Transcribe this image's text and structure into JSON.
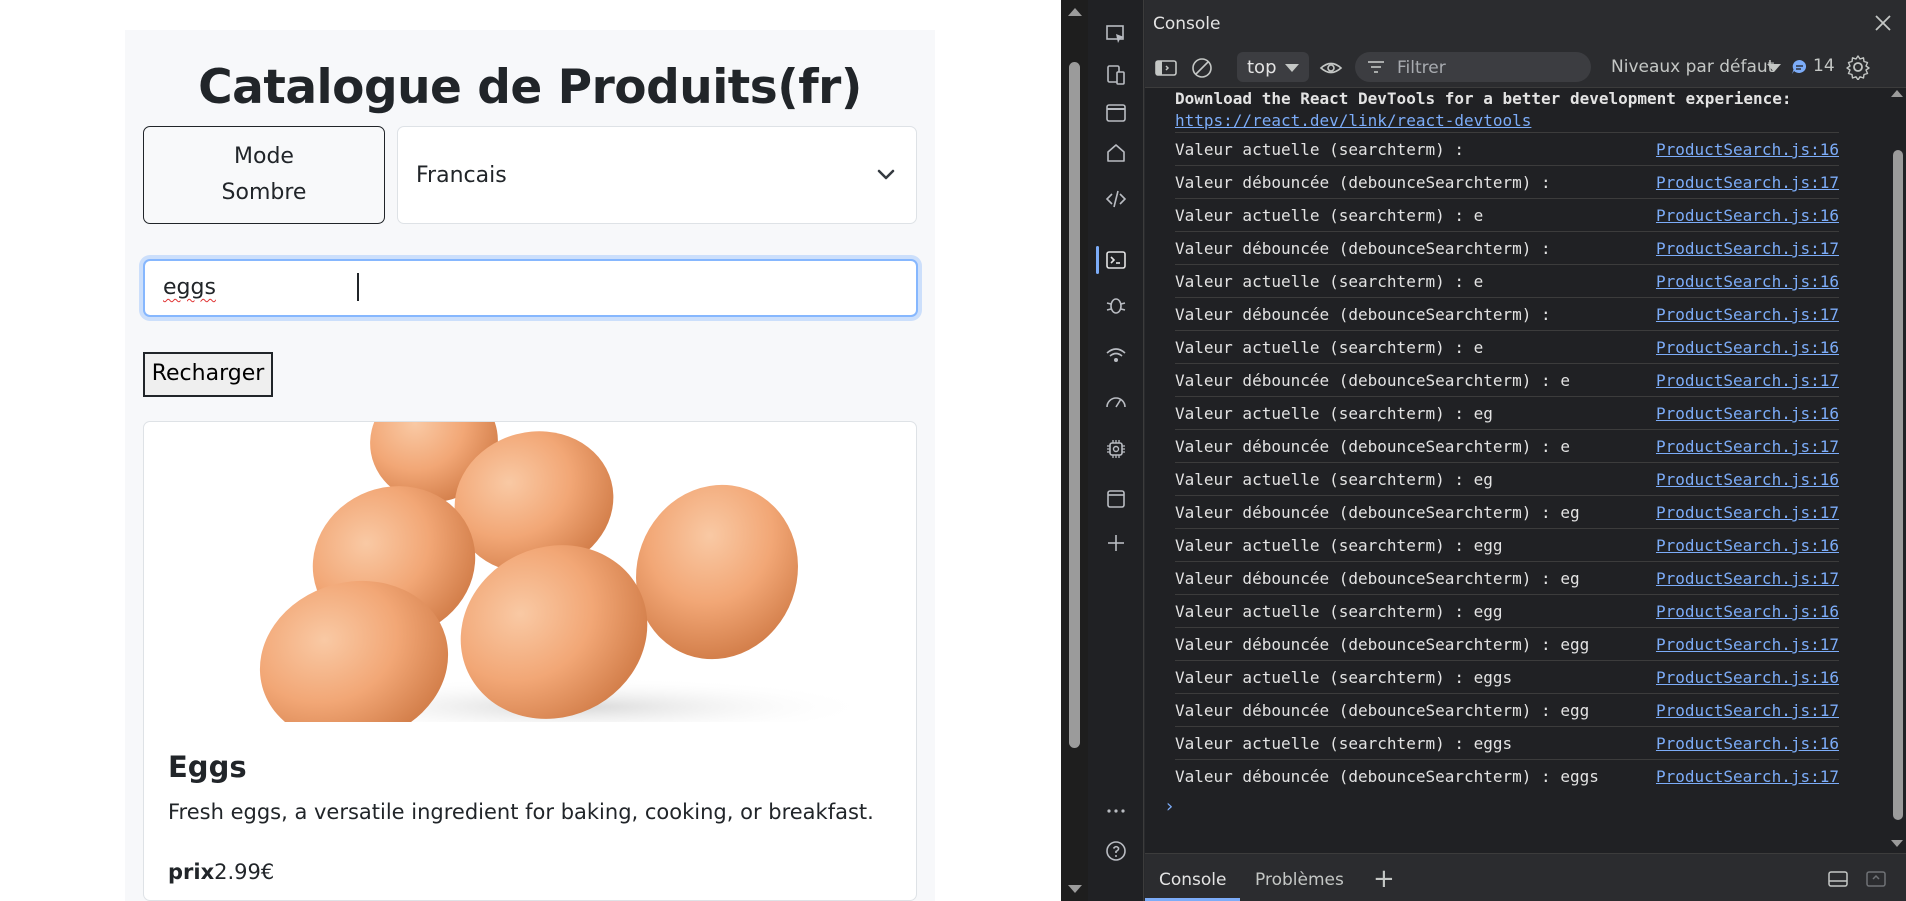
{
  "page": {
    "title": "Catalogue de Produits(fr)",
    "mode_button_label_line1": "Mode",
    "mode_button_label_line2": "Sombre",
    "language_select_value": "Francais",
    "search_value": "eggs",
    "reload_button_label": "Recharger",
    "product": {
      "name": "Eggs",
      "description": "Fresh eggs, a versatile ingredient for baking, cooking, or breakfast.",
      "price_label": "prix",
      "price_value": "2.99€"
    }
  },
  "devtools": {
    "panel_title": "Console",
    "context": "top",
    "filter_placeholder": "Filtrer",
    "levels_label": "Niveaux par défaut",
    "issues_count": "14",
    "banner_text": "Download the React DevTools for a better development experience:",
    "banner_link": "https://react.dev/link/react-devtools",
    "logs": [
      {
        "msg": "Valeur actuelle (searchterm) :",
        "src": "ProductSearch.js:16"
      },
      {
        "msg": "Valeur débouncée (debounceSearchterm) :",
        "src": "ProductSearch.js:17"
      },
      {
        "msg": "Valeur actuelle (searchterm) : e",
        "src": "ProductSearch.js:16"
      },
      {
        "msg": "Valeur débouncée (debounceSearchterm) :",
        "src": "ProductSearch.js:17"
      },
      {
        "msg": "Valeur actuelle (searchterm) : e",
        "src": "ProductSearch.js:16"
      },
      {
        "msg": "Valeur débouncée (debounceSearchterm) :",
        "src": "ProductSearch.js:17"
      },
      {
        "msg": "Valeur actuelle (searchterm) : e",
        "src": "ProductSearch.js:16"
      },
      {
        "msg": "Valeur débouncée (debounceSearchterm) : e",
        "src": "ProductSearch.js:17"
      },
      {
        "msg": "Valeur actuelle (searchterm) : eg",
        "src": "ProductSearch.js:16"
      },
      {
        "msg": "Valeur débouncée (debounceSearchterm) : e",
        "src": "ProductSearch.js:17"
      },
      {
        "msg": "Valeur actuelle (searchterm) : eg",
        "src": "ProductSearch.js:16"
      },
      {
        "msg": "Valeur débouncée (debounceSearchterm) : eg",
        "src": "ProductSearch.js:17"
      },
      {
        "msg": "Valeur actuelle (searchterm) : egg",
        "src": "ProductSearch.js:16"
      },
      {
        "msg": "Valeur débouncée (debounceSearchterm) : eg",
        "src": "ProductSearch.js:17"
      },
      {
        "msg": "Valeur actuelle (searchterm) : egg",
        "src": "ProductSearch.js:16"
      },
      {
        "msg": "Valeur débouncée (debounceSearchterm) : egg",
        "src": "ProductSearch.js:17"
      },
      {
        "msg": "Valeur actuelle (searchterm) : eggs",
        "src": "ProductSearch.js:16"
      },
      {
        "msg": "Valeur débouncée (debounceSearchterm) : egg",
        "src": "ProductSearch.js:17"
      },
      {
        "msg": "Valeur actuelle (searchterm) : eggs",
        "src": "ProductSearch.js:16"
      },
      {
        "msg": "Valeur débouncée (debounceSearchterm) : eggs",
        "src": "ProductSearch.js:17"
      }
    ],
    "drawer_tabs": [
      "Console",
      "Problèmes"
    ],
    "accent_color": "#7cacf8"
  }
}
